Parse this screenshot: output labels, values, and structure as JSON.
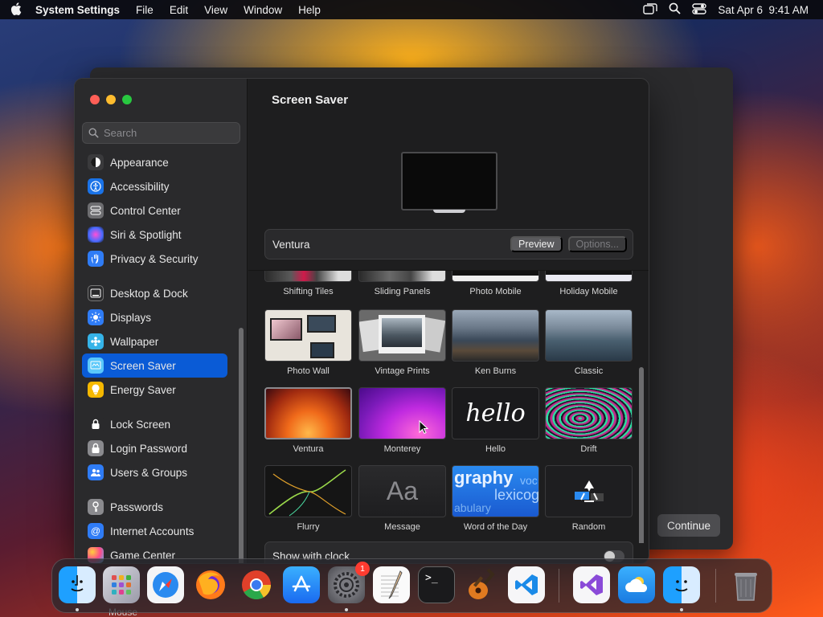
{
  "menubar": {
    "app_name": "System Settings",
    "menus": [
      "File",
      "Edit",
      "View",
      "Window",
      "Help"
    ],
    "clock": "Sat Apr 6  9:41 AM"
  },
  "search": {
    "placeholder": "Search"
  },
  "sidebar": {
    "items": [
      {
        "label": "Appearance",
        "icon": "appearance-icon",
        "color": "#3a3a3c"
      },
      {
        "label": "Accessibility",
        "icon": "accessibility-icon",
        "color": "#1a73e8"
      },
      {
        "label": "Control Center",
        "icon": "control-center-icon",
        "color": "#6d6d70"
      },
      {
        "label": "Siri & Spotlight",
        "icon": "siri-icon",
        "color": "#8a3bd8"
      },
      {
        "label": "Privacy & Security",
        "icon": "hand-icon",
        "color": "#2f7cf6"
      },
      {
        "label": "Desktop & Dock",
        "icon": "desktop-icon",
        "color": "#2a2a2c"
      },
      {
        "label": "Displays",
        "icon": "displays-icon",
        "color": "#2f7cf6"
      },
      {
        "label": "Wallpaper",
        "icon": "wallpaper-icon",
        "color": "#35b3e8"
      },
      {
        "label": "Screen Saver",
        "icon": "screen-saver-icon",
        "color": "#5ac8fa"
      },
      {
        "label": "Energy Saver",
        "icon": "energy-icon",
        "color": "#f5b800"
      },
      {
        "label": "Lock Screen",
        "icon": "lock-icon",
        "color": "#2a2a2c"
      },
      {
        "label": "Login Password",
        "icon": "login-lock-icon",
        "color": "#8a8a8e"
      },
      {
        "label": "Users & Groups",
        "icon": "users-icon",
        "color": "#2f7cf6"
      },
      {
        "label": "Passwords",
        "icon": "key-icon",
        "color": "#8a8a8e"
      },
      {
        "label": "Internet Accounts",
        "icon": "at-icon",
        "color": "#2f7cf6"
      },
      {
        "label": "Game Center",
        "icon": "game-center-icon",
        "color": "#d84a8a"
      }
    ],
    "active": "Screen Saver"
  },
  "content": {
    "title": "Screen Saver",
    "selected_saver": "Ventura",
    "preview_button": "Preview",
    "options_button": "Options...",
    "show_clock_label": "Show with clock",
    "show_clock_on": false
  },
  "savers": [
    {
      "label": "Shifting Tiles",
      "style": "partial"
    },
    {
      "label": "Sliding Panels",
      "style": "partial"
    },
    {
      "label": "Photo Mobile",
      "style": "partial"
    },
    {
      "label": "Holiday Mobile",
      "style": "partial"
    },
    {
      "label": "Photo Wall",
      "style": "photowall"
    },
    {
      "label": "Vintage Prints",
      "style": "vintage"
    },
    {
      "label": "Ken Burns",
      "style": "kenburns"
    },
    {
      "label": "Classic",
      "style": "classic"
    },
    {
      "label": "Ventura",
      "style": "ventura"
    },
    {
      "label": "Monterey",
      "style": "monterey"
    },
    {
      "label": "Hello",
      "style": "hello"
    },
    {
      "label": "Drift",
      "style": "drift"
    },
    {
      "label": "Flurry",
      "style": "flurry"
    },
    {
      "label": "Message",
      "style": "message"
    },
    {
      "label": "Word of the Day",
      "style": "word"
    },
    {
      "label": "Random",
      "style": "random"
    }
  ],
  "thumb_text": {
    "hello": "hello",
    "message": "Aa",
    "word_line1": "graphy",
    "word_line2": "lexicog",
    "word_line3": "abulary",
    "word_side": "voc"
  },
  "back_window": {
    "continue_label": "Continue"
  },
  "dock": {
    "apps": [
      {
        "name": "Finder",
        "icon": "finder-icon",
        "running": true
      },
      {
        "name": "Launchpad",
        "icon": "launchpad-icon",
        "running": false
      },
      {
        "name": "Safari",
        "icon": "safari-icon",
        "running": false
      },
      {
        "name": "Firefox",
        "icon": "firefox-icon",
        "running": false
      },
      {
        "name": "Chrome",
        "icon": "chrome-icon",
        "running": false
      },
      {
        "name": "App Store",
        "icon": "app-store-icon",
        "running": false
      },
      {
        "name": "System Settings",
        "icon": "system-settings-icon",
        "running": true,
        "badge": "1"
      },
      {
        "name": "TextEdit",
        "icon": "textedit-icon",
        "running": false
      },
      {
        "name": "Terminal",
        "icon": "terminal-icon",
        "running": false
      },
      {
        "name": "GarageBand",
        "icon": "garageband-icon",
        "running": false
      },
      {
        "name": "VS Code",
        "icon": "vscode-icon",
        "running": false
      },
      {
        "name": "Visual Studio",
        "icon": "visual-studio-icon",
        "running": false
      },
      {
        "name": "Weather",
        "icon": "weather-icon",
        "running": false
      },
      {
        "name": "Finder 2",
        "icon": "finder-alt-icon",
        "running": true
      },
      {
        "name": "Trash",
        "icon": "trash-icon",
        "running": false
      }
    ]
  },
  "peek_label": "Mouse"
}
